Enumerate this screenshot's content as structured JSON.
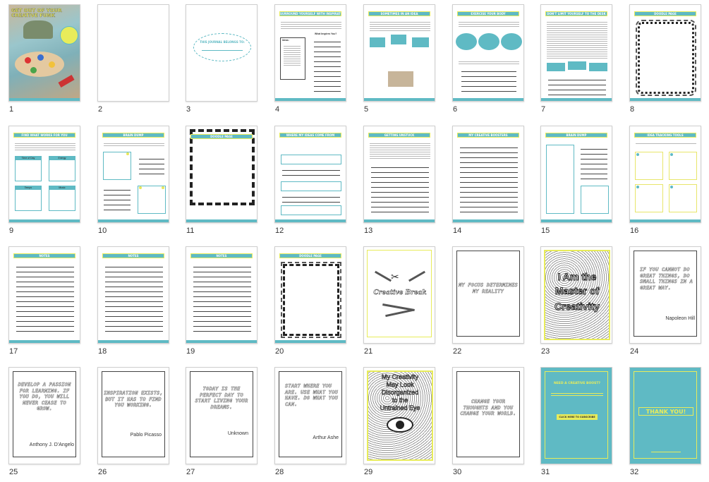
{
  "pages": [
    {
      "n": "1"
    },
    {
      "n": "2"
    },
    {
      "n": "3"
    },
    {
      "n": "4"
    },
    {
      "n": "5"
    },
    {
      "n": "6"
    },
    {
      "n": "7"
    },
    {
      "n": "8"
    },
    {
      "n": "9"
    },
    {
      "n": "10"
    },
    {
      "n": "11"
    },
    {
      "n": "12"
    },
    {
      "n": "13"
    },
    {
      "n": "14"
    },
    {
      "n": "15"
    },
    {
      "n": "16"
    },
    {
      "n": "17"
    },
    {
      "n": "18"
    },
    {
      "n": "19"
    },
    {
      "n": "20"
    },
    {
      "n": "21"
    },
    {
      "n": "22"
    },
    {
      "n": "23"
    },
    {
      "n": "24"
    },
    {
      "n": "25"
    },
    {
      "n": "26"
    },
    {
      "n": "27"
    },
    {
      "n": "28"
    },
    {
      "n": "29"
    },
    {
      "n": "30"
    },
    {
      "n": "31"
    },
    {
      "n": "32"
    }
  ],
  "titles": {
    "p1": "GET OUT OF YOUR CREATIVE FUNK",
    "p3": "THIS JOURNAL BELONGS TO:",
    "p4": "SURROUND YOURSELF WITH INSPIRATION",
    "p4_label": "What Inspires You?",
    "p4_ideas": "Ideas:",
    "p5": "SOMETIMES IN AN IDEA",
    "p6": "EXERCISE YOUR BODY",
    "p7": "DON'T LIMIT YOURSELF TO THE DESK",
    "p8": "DOODLE PAGE",
    "p9": "FIND WHAT WORKS FOR YOU",
    "p9_b1": "Time of Day",
    "p9_b2": "Energy",
    "p9_b3": "Tempo",
    "p9_b4": "Music",
    "p10": "BRAIN DUMP",
    "p11": "DOODLE PAGE",
    "p12": "WHERE MY IDEAS COME FROM",
    "p13": "GETTING UNSTUCK",
    "p14": "MY CREATIVE BOOSTERS",
    "p15": "BRAIN DUMP",
    "p16": "IDEA TRACKING TOOLS",
    "p17": "NOTES",
    "p18": "NOTES",
    "p19": "NOTES",
    "p20": "DOODLE PAGE",
    "p21": "Creative Break",
    "p23_l1": "I Am the",
    "p23_l2": "Master of",
    "p23_l3": "Creativity",
    "p29_l1": "My Creativity",
    "p29_l2": "May Look",
    "p29_l3": "Disorganized",
    "p29_l4": "to the",
    "p29_l5": "Untrained Eye",
    "p31": "NEED A CREATIVE BOOST?",
    "p31_btn": "CLICK HERE TO SUBSCRIBE",
    "p32": "THANK YOU!"
  },
  "quotes": {
    "q22": "My focus determines my reality",
    "q24": "If you cannot do great things, do small things in a great way.",
    "a24": "Napoleon Hill",
    "q25": "Develop a passion for learning. If you do, you will never cease to grow.",
    "a25": "Anthony J. D'Angelo",
    "q26": "Inspiration exists, but it has to find you working.",
    "a26": "Pablo Picasso",
    "q27": "Today is the perfect day to start living your dreams.",
    "a27": "Unknown",
    "q28": "Start where you are. Use what you have. Do what you can.",
    "a28": "Arthur Ashe",
    "q30": "Change your thoughts and you change your world."
  },
  "colors": {
    "teal": "#5fbac4",
    "yellow": "#e8ec5a"
  }
}
